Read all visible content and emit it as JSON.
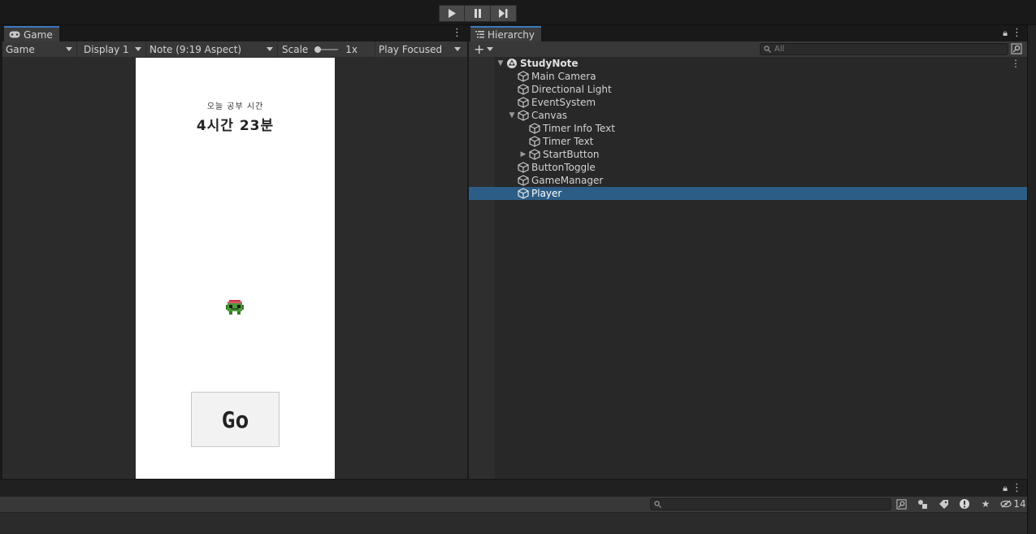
{
  "toolbar": {
    "play_icon": "play-icon",
    "pause_icon": "pause-icon",
    "step_icon": "step-icon"
  },
  "game": {
    "tab_label": "Game",
    "mode": "Game",
    "display": "Display 1",
    "aspect": "Note (9:19 Aspect)",
    "scale_label": "Scale",
    "scale_value": "1x",
    "play_mode": "Play Focused",
    "info_text": "오늘 공부 시간",
    "timer_text": "4시간 23분",
    "button_label": "Go"
  },
  "hierarchy": {
    "tab_label": "Hierarchy",
    "search_placeholder": "All",
    "scene": "StudyNote",
    "items": [
      {
        "label": "Main Camera"
      },
      {
        "label": "Directional Light"
      },
      {
        "label": "EventSystem"
      },
      {
        "label": "Canvas"
      },
      {
        "label": "Timer Info Text"
      },
      {
        "label": "Timer Text"
      },
      {
        "label": "StartButton"
      },
      {
        "label": "ButtonToggle"
      },
      {
        "label": "GameManager"
      },
      {
        "label": "Player"
      }
    ],
    "selected": "Player"
  },
  "bottom": {
    "hidden_count": "14"
  },
  "colors": {
    "accent": "#3a79bb",
    "selection": "#2c5d87"
  }
}
